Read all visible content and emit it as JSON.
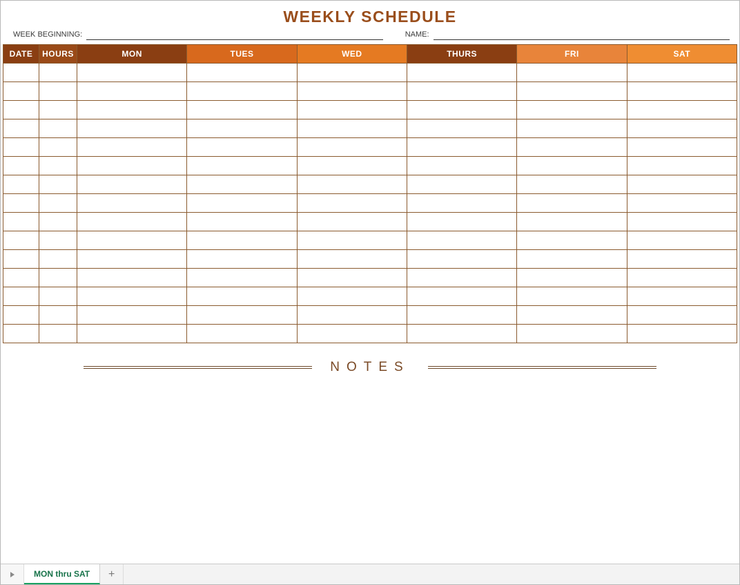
{
  "title": "WEEKLY SCHEDULE",
  "meta": {
    "week_beginning_label": "WEEK BEGINNING:",
    "week_beginning_value": "",
    "name_label": "NAME:",
    "name_value": ""
  },
  "headers": {
    "date": "DATE",
    "hours": "HOURS",
    "days": [
      "MON",
      "TUES",
      "WED",
      "THURS",
      "FRI",
      "SAT"
    ]
  },
  "row_count": 15,
  "notes_label": "NOTES",
  "tabs": {
    "active": "MON thru SAT"
  },
  "chart_data": {
    "type": "table",
    "title": "WEEKLY SCHEDULE",
    "columns": [
      "DATE",
      "HOURS",
      "MON",
      "TUES",
      "WED",
      "THURS",
      "FRI",
      "SAT"
    ],
    "rows": [
      [
        "",
        "",
        "",
        "",
        "",
        "",
        "",
        ""
      ],
      [
        "",
        "",
        "",
        "",
        "",
        "",
        "",
        ""
      ],
      [
        "",
        "",
        "",
        "",
        "",
        "",
        "",
        ""
      ],
      [
        "",
        "",
        "",
        "",
        "",
        "",
        "",
        ""
      ],
      [
        "",
        "",
        "",
        "",
        "",
        "",
        "",
        ""
      ],
      [
        "",
        "",
        "",
        "",
        "",
        "",
        "",
        ""
      ],
      [
        "",
        "",
        "",
        "",
        "",
        "",
        "",
        ""
      ],
      [
        "",
        "",
        "",
        "",
        "",
        "",
        "",
        ""
      ],
      [
        "",
        "",
        "",
        "",
        "",
        "",
        "",
        ""
      ],
      [
        "",
        "",
        "",
        "",
        "",
        "",
        "",
        ""
      ],
      [
        "",
        "",
        "",
        "",
        "",
        "",
        "",
        ""
      ],
      [
        "",
        "",
        "",
        "",
        "",
        "",
        "",
        ""
      ],
      [
        "",
        "",
        "",
        "",
        "",
        "",
        "",
        ""
      ],
      [
        "",
        "",
        "",
        "",
        "",
        "",
        "",
        ""
      ],
      [
        "",
        "",
        "",
        "",
        "",
        "",
        "",
        ""
      ]
    ]
  }
}
